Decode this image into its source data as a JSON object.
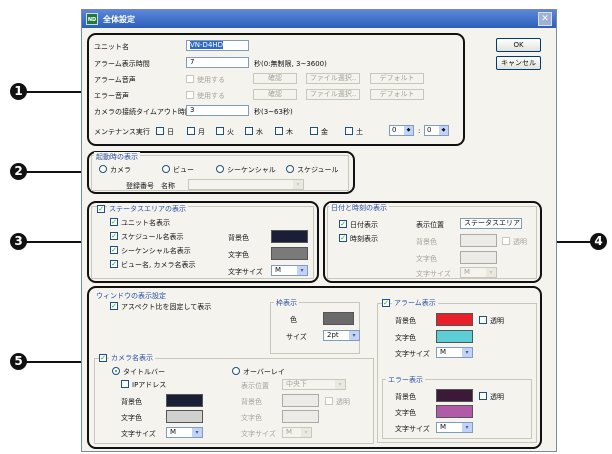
{
  "window": {
    "title": "全体設定",
    "app_icon": "ND"
  },
  "callouts": [
    "1",
    "2",
    "3",
    "4",
    "5"
  ],
  "buttons": {
    "ok": "OK",
    "cancel": "キャンセル"
  },
  "general": {
    "unit_name_label": "ユニット名",
    "unit_name_value": "VN-D4HD",
    "alarm_time_label": "アラーム表示時間",
    "alarm_time_value": "7",
    "alarm_time_hint": "秒(0:無制限, 3~3600)",
    "alarm_sound_label": "アラーム音声",
    "error_sound_label": "エラー音声",
    "use_label": "使用する",
    "confirm_label": "確認",
    "file_select_label": "ファイル選択..",
    "default_label": "デフォルト",
    "camera_timeout_label": "カメラの接続タイムアウト時間",
    "camera_timeout_value": "3",
    "camera_timeout_hint": "秒(3~63秒)",
    "maintenance_label": "メンテナンス実行",
    "days": [
      "日",
      "月",
      "火",
      "水",
      "木",
      "金",
      "土"
    ],
    "hour": "0",
    "minute": "0",
    "time_sep": ":"
  },
  "startup": {
    "title": "起動時の表示",
    "options": [
      "カメラ",
      "ビュー",
      "シーケンシャル",
      "スケジュール"
    ],
    "reg_label": "登録番号",
    "name_label": "名称"
  },
  "status_area": {
    "title": "ステータスエリアの表示",
    "items": [
      "ユニット名表示",
      "スケジュール名表示",
      "シーケンシャル名表示",
      "ビュー名, カメラ名表示"
    ],
    "bg_label": "背景色",
    "text_label": "文字色",
    "size_label": "文字サイズ",
    "size_value": "M",
    "bg_color": "#1a1e36",
    "text_color": "#7a7a7a"
  },
  "datetime": {
    "title": "日付と時刻の表示",
    "date_label": "日付表示",
    "time_label": "時刻表示",
    "pos_label": "表示位置",
    "pos_value": "ステータスエリア",
    "bg_label": "背景色",
    "transparent_label": "透明",
    "text_label": "文字色",
    "size_label": "文字サイズ",
    "size_value": "M"
  },
  "window_display": {
    "title": "ウィンドウの表示設定",
    "aspect_label": "アスペクト比を固定して表示",
    "frame": {
      "title": "枠表示",
      "color_label": "色",
      "size_label": "サイズ",
      "size_value": "2pt",
      "color": "#6a6a6a"
    },
    "camera_name": {
      "title": "カメラ名表示",
      "titlebar_label": "タイトルバー",
      "ip_label": "IPアドレス",
      "bg_label": "背景色",
      "text_label": "文字色",
      "size_label": "文字サイズ",
      "size_value": "M",
      "bg_color": "#1a1e36",
      "text_color": "#d0d0d0"
    },
    "overlay": {
      "label": "オーバーレイ",
      "pos_label": "表示位置",
      "pos_value": "中央下",
      "bg_label": "背景色",
      "transparent_label": "透明",
      "text_label": "文字色",
      "size_label": "文字サイズ",
      "size_value": "M"
    },
    "alarm": {
      "title": "アラーム表示",
      "bg_label": "背景色",
      "transparent_label": "透明",
      "text_label": "文字色",
      "size_label": "文字サイズ",
      "size_value": "M",
      "bg_color": "#e8202a",
      "text_color": "#5ccfd6"
    },
    "error": {
      "title": "エラー表示",
      "bg_label": "背景色",
      "transparent_label": "透明",
      "text_label": "文字色",
      "size_label": "文字サイズ",
      "size_value": "M",
      "bg_color": "#3a1a36",
      "text_color": "#b05aa8"
    }
  },
  "marks": {
    "check": "✓",
    "arrow": "▾",
    "spin": "◆",
    "close": "✕"
  }
}
